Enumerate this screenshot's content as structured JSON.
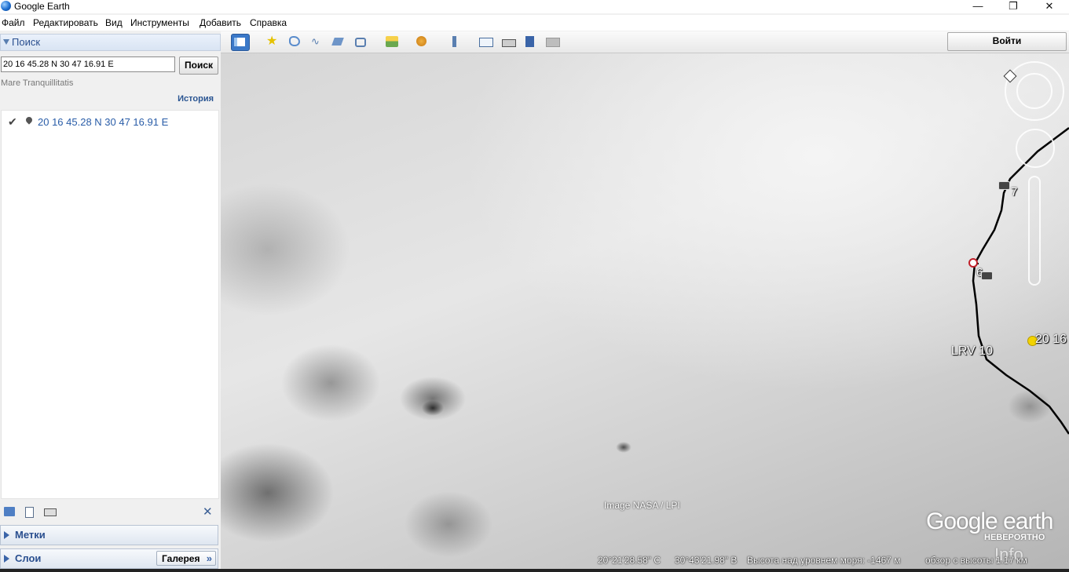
{
  "window": {
    "title": "Google Earth",
    "minimize": "—",
    "maximize": "❐",
    "close": "✕"
  },
  "menu": [
    "Файл",
    "Редактировать",
    "Вид",
    "Инструменты",
    "Добавить",
    "Справка"
  ],
  "search_panel": {
    "header": "Поиск",
    "input_value": "20 16 45.28 N 30 47 16.91 E",
    "button": "Поиск",
    "suggestion": "Mare Tranquillitatis",
    "history_link": "История",
    "results": [
      {
        "text": "20 16 45.28 N 30 47 16.91 E"
      }
    ]
  },
  "places_panel": {
    "label": "Метки"
  },
  "layers_panel": {
    "label": "Слои",
    "gallery_button": "Галерея"
  },
  "toolbar": {
    "icons": [
      "sidebar-toggle-icon",
      "add-placemark-icon",
      "add-polygon-icon",
      "add-path-icon",
      "add-image-overlay-icon",
      "record-tour-icon",
      "sunlight-icon",
      "planets-icon",
      "ruler-icon",
      "email-icon",
      "print-icon",
      "save-image-icon",
      "view-in-maps-icon"
    ],
    "login": "Войти"
  },
  "map": {
    "labels": {
      "station7": "7",
      "station6": "6",
      "lrv": "LRV 10",
      "placemark": "20 16"
    },
    "attribution": "Image NASA / LPI",
    "logo": "Google earth",
    "watermark_top": "НЕВЕРОЯТНО",
    "watermark_bottom": "Info"
  },
  "status": {
    "lat": "20°21'28.58\" С",
    "lon": "30°43'21.98\" В",
    "elevation": "Высота над уровнем моря:  -1467 м",
    "eye_alt": "обзор с высоты    1.17 км"
  }
}
